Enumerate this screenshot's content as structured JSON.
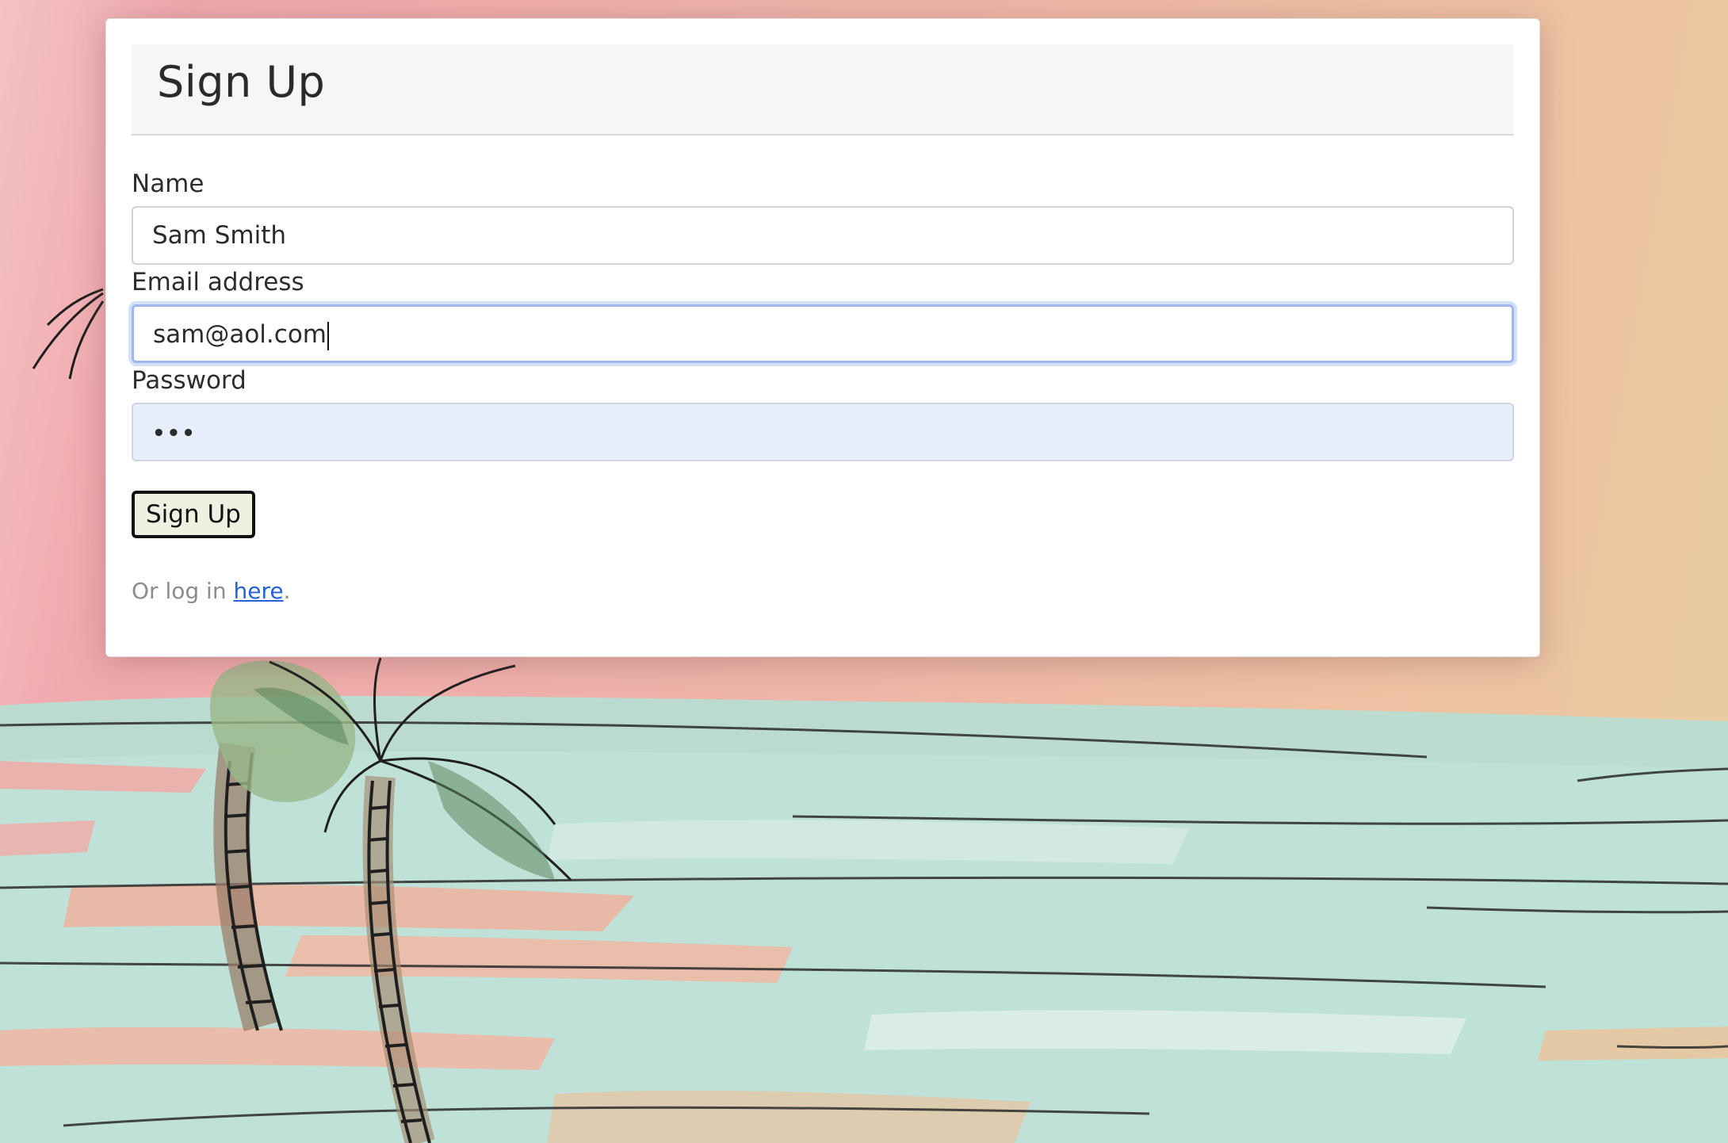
{
  "form": {
    "title": "Sign Up",
    "name": {
      "label": "Name",
      "value": "Sam Smith"
    },
    "email": {
      "label": "Email address",
      "value": "sam@aol.com"
    },
    "password": {
      "label": "Password",
      "value": "•••"
    },
    "submit_label": "Sign Up",
    "login_prefix": "Or log in ",
    "login_link": "here",
    "login_suffix": "."
  },
  "colors": {
    "link": "#2563d9",
    "focus_ring": "#9fb7ef",
    "autofill_bg": "#e8effc",
    "button_bg": "#eef1e0"
  }
}
